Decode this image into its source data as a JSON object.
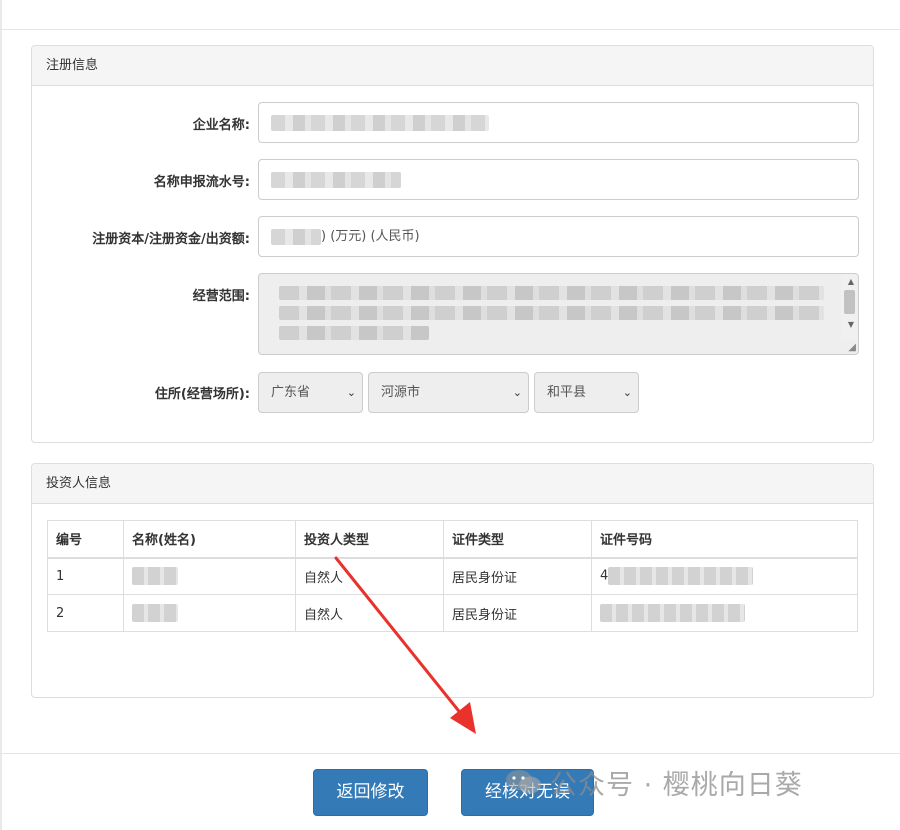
{
  "registration": {
    "title": "注册信息",
    "company_name_label": "企业名称:",
    "serial_label": "名称申报流水号:",
    "capital_label": "注册资本/注册资金/出资额:",
    "capital_suffix": ") (万元) (人民币)",
    "scope_label": "经营范围:",
    "address_label": "住所(经营场所):",
    "province": "广东省",
    "city": "河源市",
    "county": "和平县"
  },
  "investors": {
    "title": "投资人信息",
    "columns": [
      "编号",
      "名称(姓名)",
      "投资人类型",
      "证件类型",
      "证件号码"
    ],
    "rows": [
      {
        "no": "1",
        "type": "自然人",
        "id_type": "居民身份证",
        "id_prefix": "4"
      },
      {
        "no": "2",
        "type": "自然人",
        "id_type": "居民身份证",
        "id_prefix": ""
      }
    ]
  },
  "buttons": {
    "back": "返回修改",
    "confirm": "经核对无误"
  },
  "watermark": {
    "text": "公众号 · 樱桃向日葵"
  },
  "colors": {
    "primary": "#337ab7",
    "annotation_arrow": "#e8322b"
  }
}
